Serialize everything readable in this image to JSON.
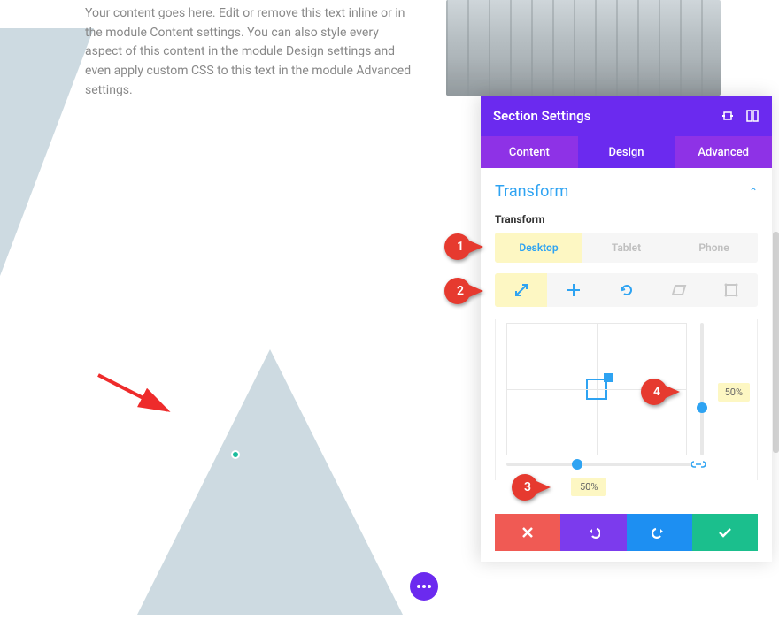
{
  "content": {
    "placeholder_text": "Your content goes here. Edit or remove this text inline or in the module Content settings. You can also style every aspect of this content in the module Design settings and even apply custom CSS to this text in the module Advanced settings."
  },
  "panel": {
    "title": "Section Settings",
    "tabs": {
      "content": "Content",
      "design": "Design",
      "advanced": "Advanced"
    },
    "section": {
      "title": "Transform",
      "field_label": "Transform",
      "devices": {
        "desktop": "Desktop",
        "tablet": "Tablet",
        "phone": "Phone"
      },
      "tools": {
        "scale": "scale-tool",
        "translate": "translate-tool",
        "rotate": "rotate-tool",
        "skew": "skew-tool",
        "origin": "origin-tool"
      },
      "values": {
        "horizontal": "50%",
        "vertical": "50%"
      }
    }
  },
  "callouts": {
    "1": "1",
    "2": "2",
    "3": "3",
    "4": "4"
  }
}
